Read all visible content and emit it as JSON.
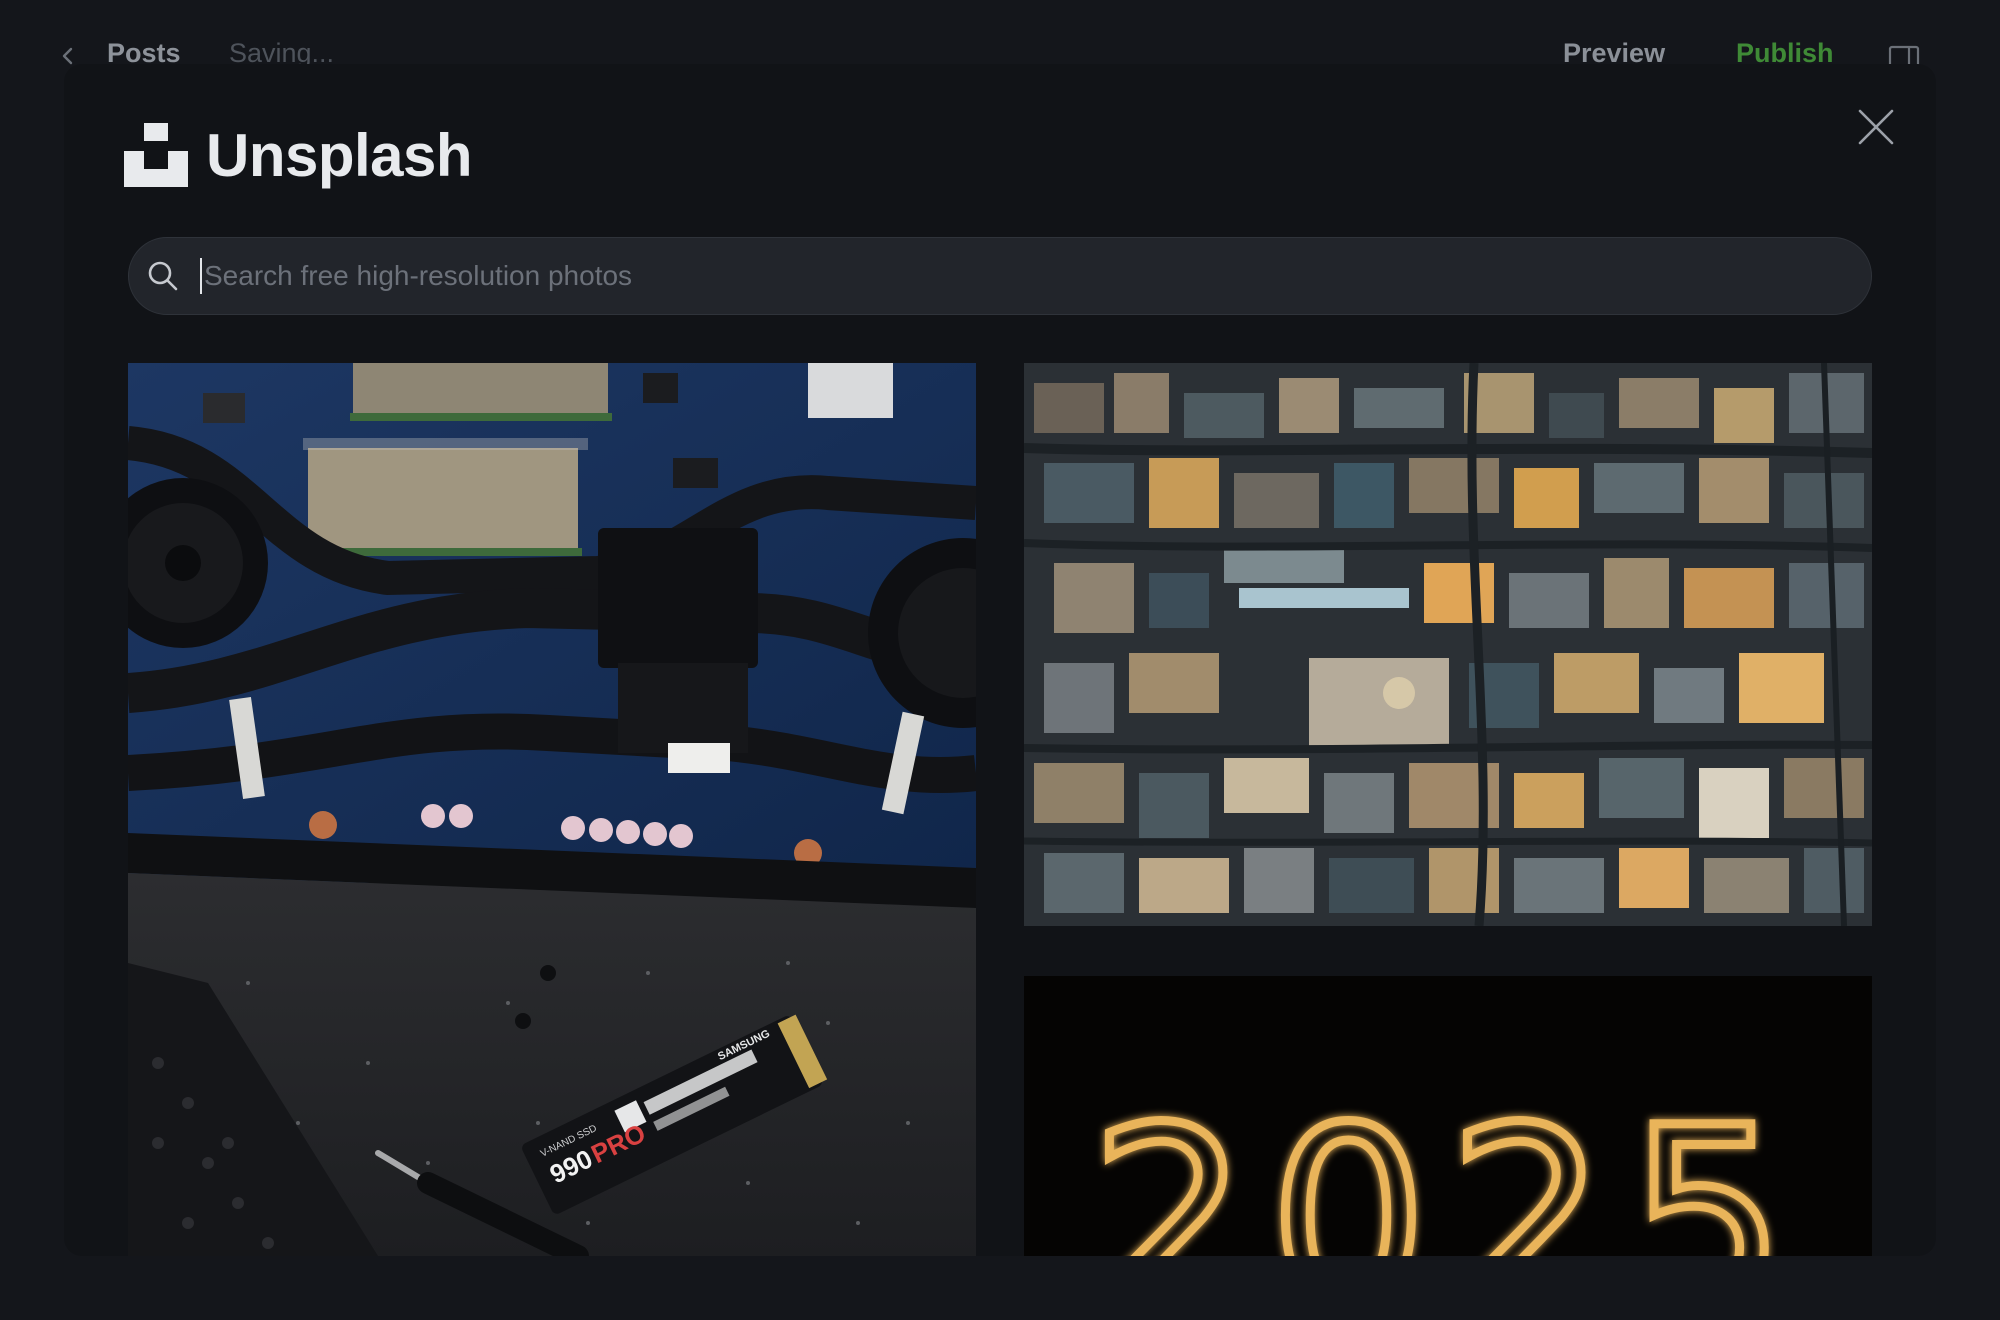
{
  "editor": {
    "breadcrumb": "Posts",
    "status": "Saving...",
    "preview_label": "Preview",
    "publish_label": "Publish",
    "publish_color": "#3f8a36"
  },
  "modal": {
    "brand": "Unsplash",
    "search": {
      "placeholder": "Search free high-resolution photos",
      "value": ""
    },
    "photos": [
      {
        "subject": "laptop-motherboard-ssd",
        "ssd_brand": "SAMSUNG",
        "ssd_label_1": "V-NAND SSD",
        "ssd_model": "990",
        "ssd_model_suffix": "PRO"
      },
      {
        "subject": "aerial-city-rooftops"
      },
      {
        "subject": "sparkler-new-year",
        "text": "2025"
      }
    ]
  },
  "icons": {
    "back": "chevron-left-icon",
    "sidebar": "sidebar-toggle-icon",
    "close": "close-icon",
    "search": "search-icon",
    "logo": "unsplash-logo"
  }
}
